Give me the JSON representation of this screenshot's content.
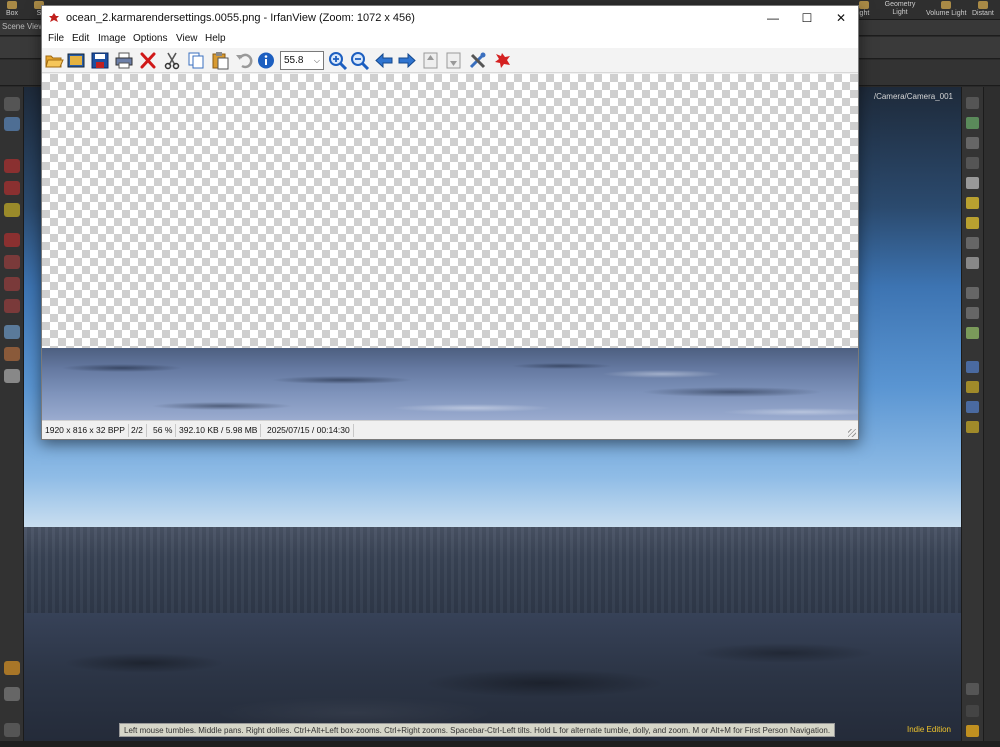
{
  "houdini": {
    "shelf": [
      "Box",
      "S",
      "ight",
      "Geometry Light",
      "Volume Light",
      "Distant"
    ],
    "scene_view_tab": "Scene View",
    "camera_label": "/Camera/Camera_001",
    "status_text": "Left mouse tumbles. Middle pans. Right dollies. Ctrl+Alt+Left box-zooms. Ctrl+Right zooms. Spacebar-Ctrl-Left tilts. Hold L for alternate tumble, dolly, and zoom. M or Alt+M for First Person Navigation.",
    "edition": "Indie Edition"
  },
  "irfanview": {
    "title": "ocean_2.karmarendersettings.0055.png - IrfanView (Zoom: 1072 x 456)",
    "window_controls": {
      "minimize": "—",
      "maximize": "☐",
      "close": "✕"
    },
    "menu": [
      "File",
      "Edit",
      "Image",
      "Options",
      "View",
      "Help"
    ],
    "zoom_value": "55.8",
    "toolbar_icons": [
      "open-icon",
      "slideshow-icon",
      "save-icon",
      "print-icon",
      "delete-icon",
      "cut-icon",
      "copy-icon",
      "paste-icon",
      "undo-icon",
      "info-icon",
      "zoom-in-icon",
      "zoom-out-icon",
      "prev-icon",
      "next-icon",
      "first-page-icon",
      "last-page-icon",
      "settings-icon",
      "exit-icon"
    ],
    "status": {
      "dimensions": "1920 x 816 x 32 BPP",
      "page": "2/2",
      "zoom": "56 %",
      "size": "392.10 KB / 5.98 MB",
      "datetime": "2025/07/15 / 00:14:30"
    }
  }
}
